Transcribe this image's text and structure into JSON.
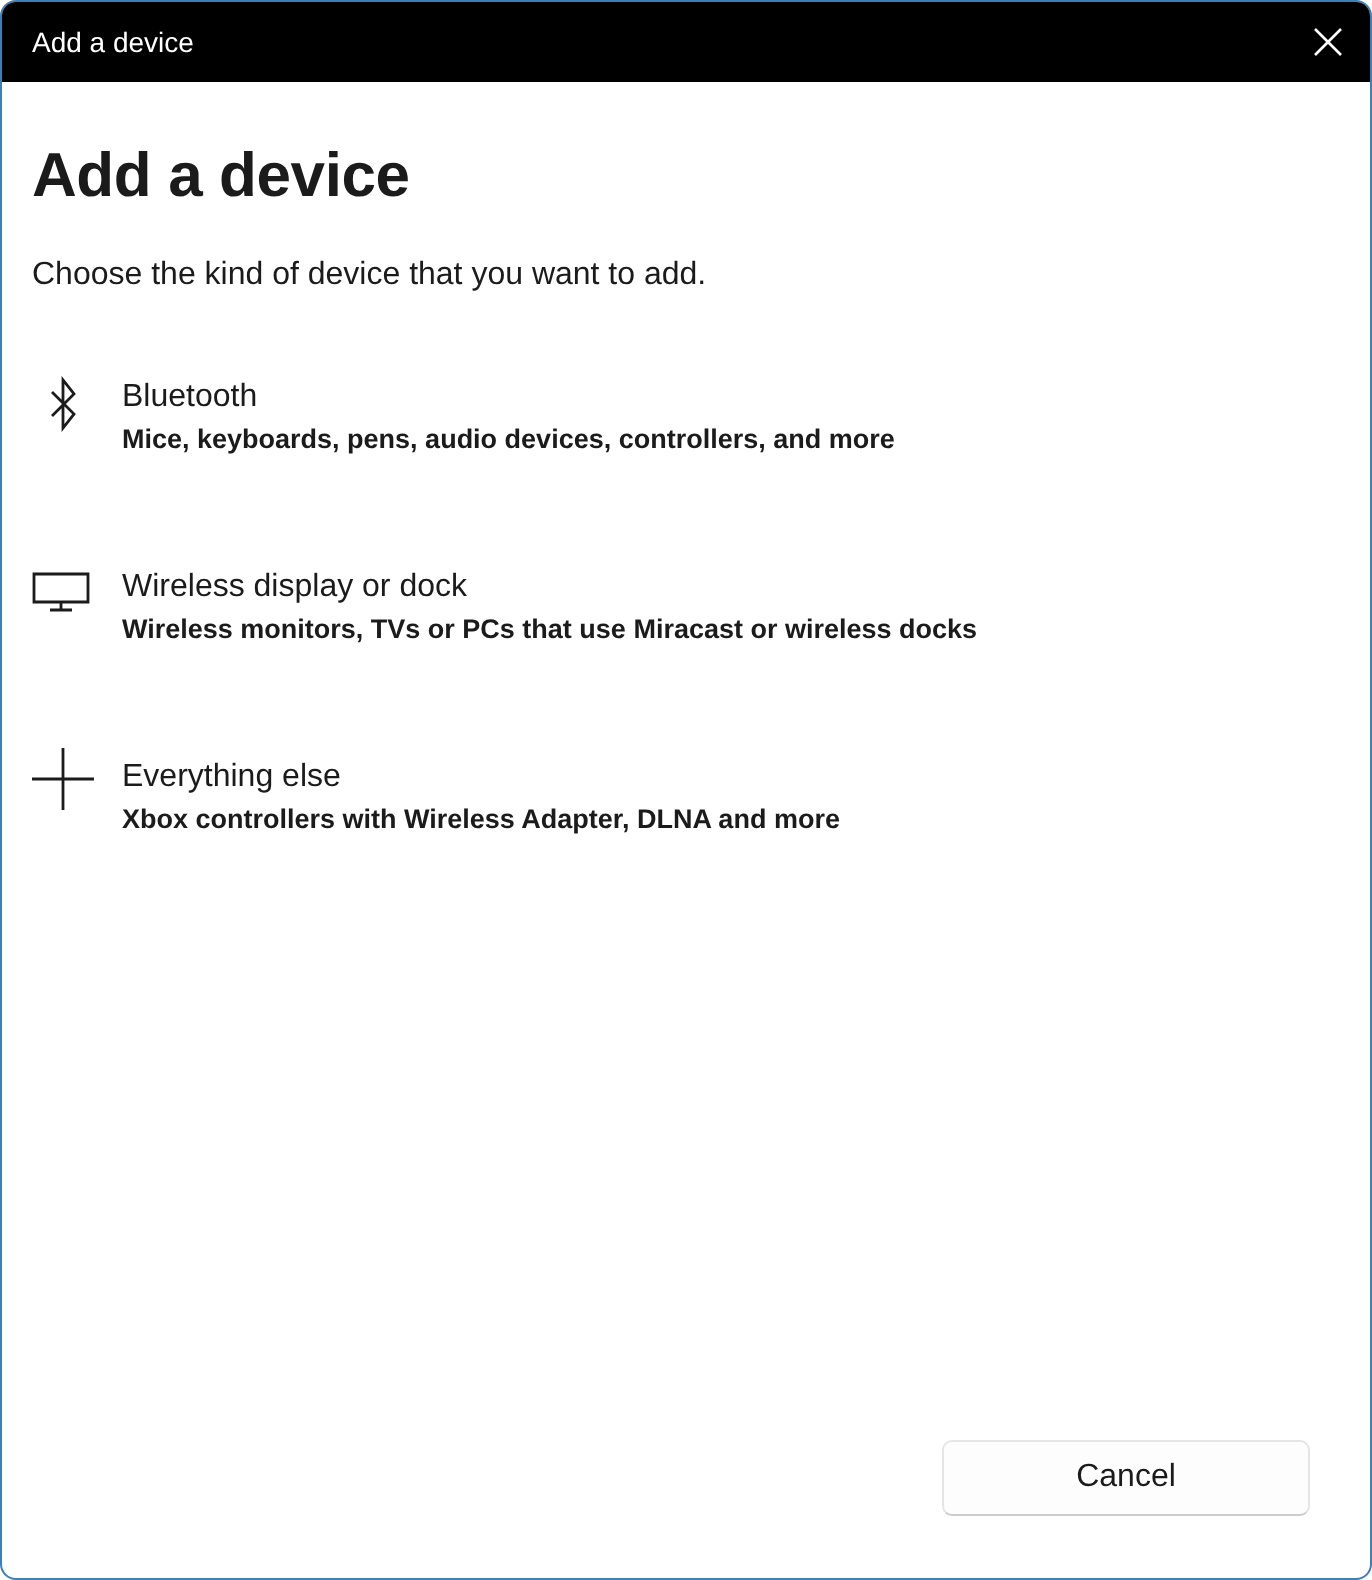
{
  "window": {
    "title": "Add a device"
  },
  "heading": "Add a device",
  "instruction": "Choose the kind of device that you want to add.",
  "options": [
    {
      "kind": "bluetooth",
      "title": "Bluetooth",
      "description": "Mice, keyboards, pens, audio devices, controllers, and more"
    },
    {
      "kind": "display",
      "title": "Wireless display or dock",
      "description": "Wireless monitors, TVs or PCs that use Miracast or wireless docks"
    },
    {
      "kind": "other",
      "title": "Everything else",
      "description": "Xbox controllers with Wireless Adapter, DLNA and more"
    }
  ],
  "buttons": [
    "Cancel"
  ]
}
